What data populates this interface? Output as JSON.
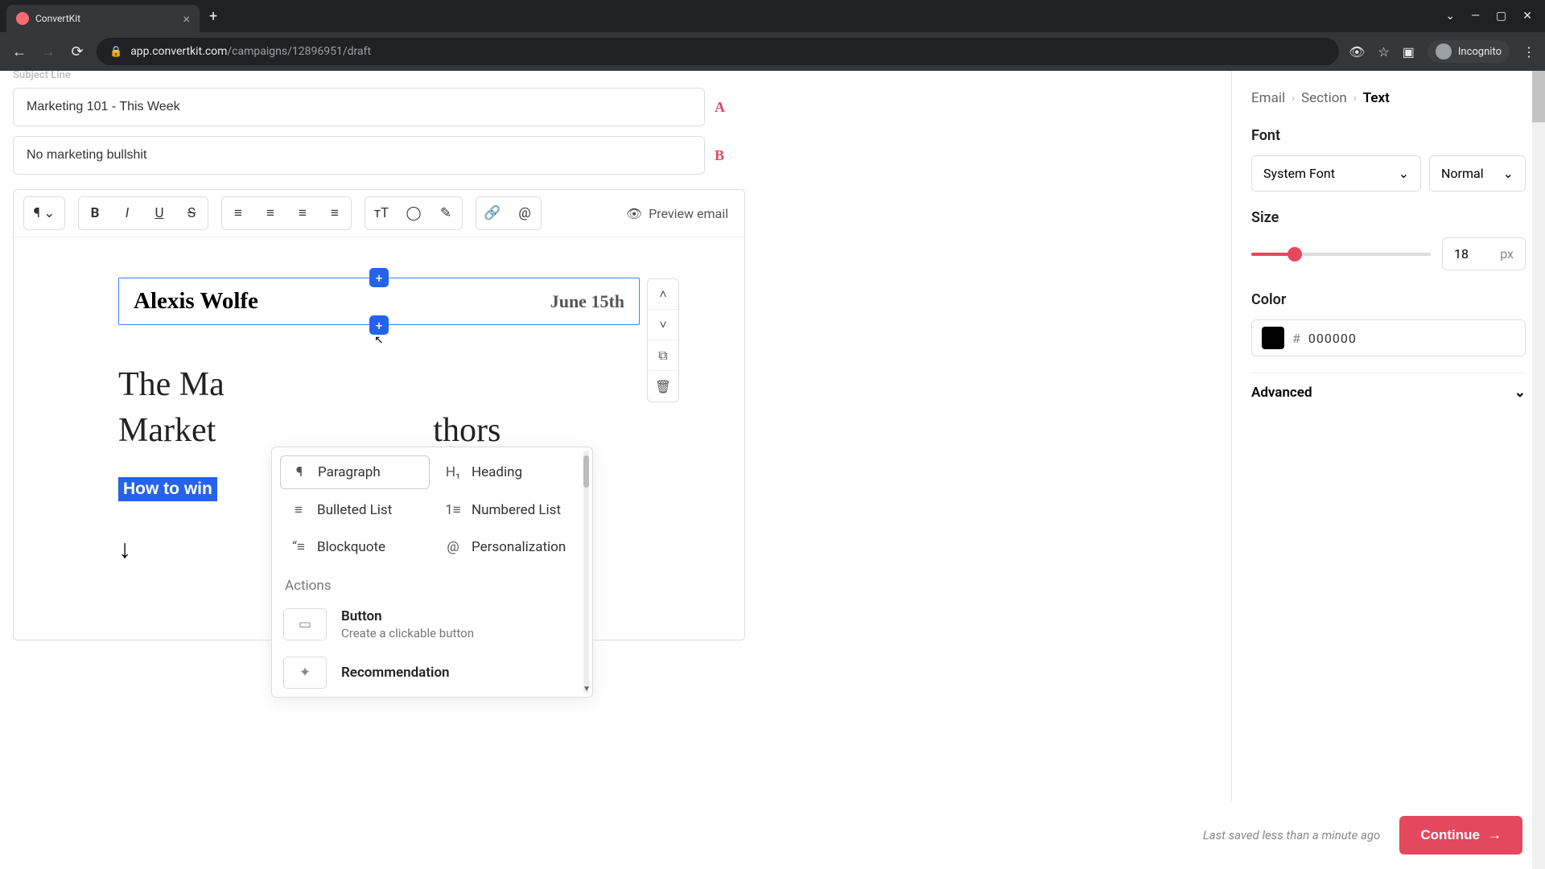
{
  "browser": {
    "tab_title": "ConvertKit",
    "url_host": "app.convertkit.com",
    "url_path": "/campaigns/12896951/draft",
    "incognito_label": "Incognito"
  },
  "subject": {
    "label": "Subject Line",
    "variant_a": "Marketing 101 - This Week",
    "variant_b": "No marketing bullshit",
    "badge_a": "A",
    "badge_b": "B"
  },
  "toolbar": {
    "preview": "Preview email"
  },
  "canvas": {
    "author": "Alexis Wolfe",
    "date": "June 15th",
    "heading_line1": "The Ma",
    "heading_line2": "Market",
    "heading_tail": "thors",
    "highlight": "How to win ",
    "arrow": "↓"
  },
  "picker": {
    "items": [
      {
        "label": "Paragraph",
        "icon": "¶"
      },
      {
        "label": "Heading",
        "icon": "H₁"
      },
      {
        "label": "Bulleted List",
        "icon": "≡"
      },
      {
        "label": "Numbered List",
        "icon": "1≡"
      },
      {
        "label": "Blockquote",
        "icon": "“≡"
      },
      {
        "label": "Personalization",
        "icon": "@"
      }
    ],
    "section_label": "Actions",
    "actions": [
      {
        "title": "Button",
        "desc": "Create a clickable button",
        "thumb": "▭"
      },
      {
        "title": "Recommendation",
        "desc": "",
        "thumb": "✦"
      }
    ]
  },
  "panel": {
    "crumbs": [
      "Email",
      "Section",
      "Text"
    ],
    "font_label": "Font",
    "font_family": "System Font",
    "font_weight": "Normal",
    "size_label": "Size",
    "size_value": "18",
    "size_unit": "px",
    "color_label": "Color",
    "color_hex": "000000",
    "advanced_label": "Advanced"
  },
  "footer": {
    "saved": "Last saved less than a minute ago",
    "continue": "Continue"
  }
}
